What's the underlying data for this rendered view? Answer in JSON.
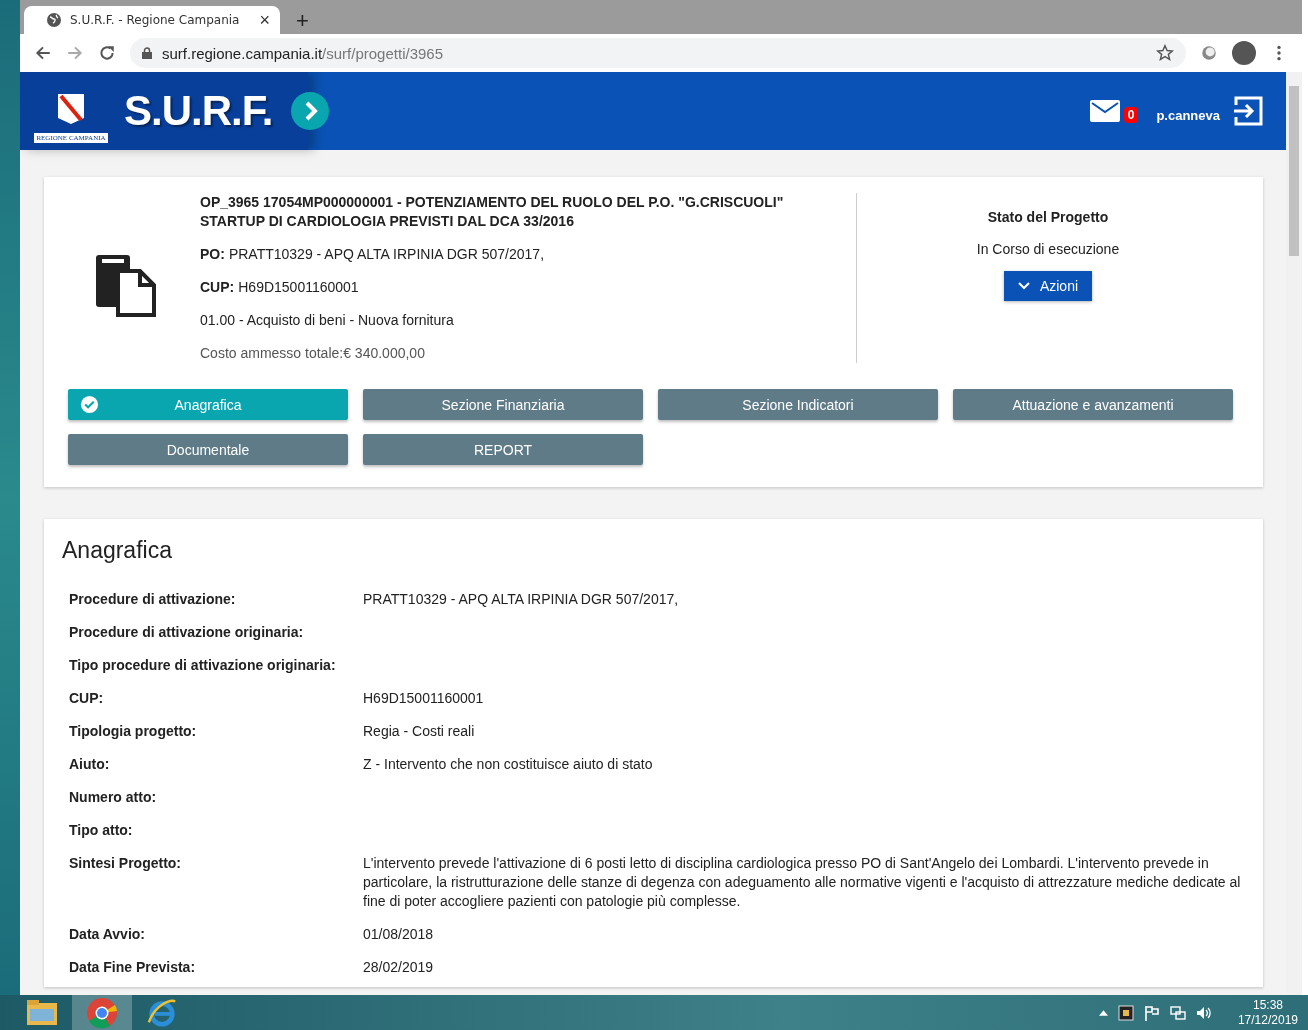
{
  "browser": {
    "tab_title": "S.U.R.F. - Regione Campania",
    "tab_close": "×",
    "new_tab": "+",
    "url_host": "surf.regione.campania.it",
    "url_path": "/surf/progetti/3965"
  },
  "header": {
    "logo_caption": "REGIONE CAMPANIA",
    "brand": "S.U.R.F.",
    "mail_count": "0",
    "username": "p.canneva"
  },
  "project": {
    "title": "OP_3965 17054MP000000001 - POTENZIAMENTO DEL RUOLO DEL P.O. \"G.CRISCUOLI\" STARTUP DI CARDIOLOGIA PREVISTI DAL DCA 33/2016",
    "lines": [
      {
        "label": "PO:",
        "value": "PRATT10329 - APQ ALTA IRPINIA DGR 507/2017,"
      },
      {
        "label": "CUP:",
        "value": "H69D15001160001"
      },
      {
        "value": "01.00 - Acquisto di beni - Nuova fornitura"
      }
    ],
    "cost": "Costo ammesso totale:€ 340.000,00",
    "status_title": "Stato del Progetto",
    "status": "In Corso di esecuzione",
    "actions_button": "Azioni"
  },
  "sections": [
    {
      "label": "Anagrafica",
      "selected": true
    },
    {
      "label": "Sezione Finanziaria",
      "selected": false
    },
    {
      "label": "Sezione Indicatori",
      "selected": false
    },
    {
      "label": "Attuazione e avanzamenti",
      "selected": false
    },
    {
      "label": "Documentale",
      "selected": false
    },
    {
      "label": "REPORT",
      "selected": false
    }
  ],
  "details": {
    "heading": "Anagrafica",
    "rows": [
      {
        "label": "Procedure di attivazione:",
        "value": "PRATT10329 - APQ ALTA IRPINIA DGR 507/2017,"
      },
      {
        "label": "Procedure di attivazione originaria:"
      },
      {
        "label": "Tipo procedure di attivazione originaria:"
      },
      {
        "label": "CUP:",
        "value": "H69D15001160001"
      },
      {
        "label": "Tipologia progetto:",
        "value": "Regia - Costi reali"
      },
      {
        "label": "Aiuto:",
        "value": "Z - Intervento che non costituisce aiuto di stato"
      },
      {
        "label": "Numero atto:"
      },
      {
        "label": "Tipo atto:"
      },
      {
        "label": "Sintesi Progetto:",
        "value": "L'intervento prevede l'attivazione di 6 posti letto di disciplina cardiologica presso PO di Sant'Angelo dei Lombardi. L'intervento prevede in particolare, la ristrutturazione delle stanze di degenza con adeguamento alle normative vigenti e l'acquisto di attrezzature mediche dedicate al fine di poter accogliere pazienti con patologie più complesse."
      },
      {
        "label": "Data Avvio:",
        "value": "01/08/2018"
      },
      {
        "label": "Data Fine Prevista:",
        "value": "28/02/2019"
      }
    ]
  },
  "taskbar": {
    "time": "15:38",
    "date": "17/12/2019"
  }
}
